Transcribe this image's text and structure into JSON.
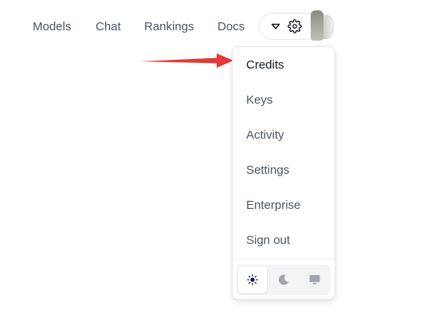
{
  "nav": {
    "links": [
      "Models",
      "Chat",
      "Rankings",
      "Docs"
    ]
  },
  "account": {
    "caret_icon": "caret-down-icon",
    "settings_icon": "gear-icon",
    "avatar": "user-avatar"
  },
  "menu": {
    "items": [
      "Credits",
      "Keys",
      "Activity",
      "Settings",
      "Enterprise",
      "Sign out"
    ],
    "theme_options": [
      {
        "icon": "sun-icon",
        "selected": true
      },
      {
        "icon": "moon-icon",
        "selected": false
      },
      {
        "icon": "monitor-icon",
        "selected": false
      }
    ]
  },
  "annotation": {
    "arrow_color": "#e53935"
  },
  "colors": {
    "text_primary": "#111827",
    "text_secondary": "#4b5563",
    "border": "#e5e7eb",
    "theme_group_bg": "#f3f4f6"
  }
}
